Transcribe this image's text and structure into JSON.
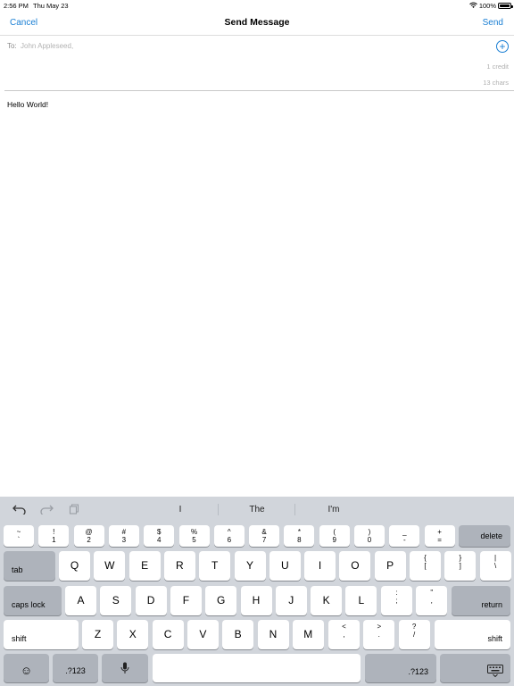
{
  "status_bar": {
    "time": "2:56 PM",
    "date": "Thu May 23",
    "battery_percent": "100%",
    "battery_level": 1.0
  },
  "nav": {
    "cancel": "Cancel",
    "title": "Send Message",
    "send": "Send"
  },
  "recipients": {
    "label": "To:",
    "value": "John Appleseed,",
    "add_icon": "plus-circle-icon"
  },
  "counters": {
    "credit": "1 credit",
    "chars": "13 chars"
  },
  "message": {
    "body": "Hello World!"
  },
  "keyboard": {
    "shortcuts": {
      "undo_icon": "undo-icon",
      "redo_icon": "redo-icon",
      "paste_icon": "clipboard-icon"
    },
    "suggestions": [
      "I",
      "The",
      "I'm"
    ],
    "row_numbers": [
      [
        "~",
        "`"
      ],
      [
        "!",
        "1"
      ],
      [
        "@",
        "2"
      ],
      [
        "#",
        "3"
      ],
      [
        "$",
        "4"
      ],
      [
        "%",
        "5"
      ],
      [
        "^",
        "6"
      ],
      [
        "&",
        "7"
      ],
      [
        "*",
        "8"
      ],
      [
        "(",
        "9"
      ],
      [
        ")",
        "0"
      ],
      [
        "_",
        "-"
      ],
      [
        "+",
        "="
      ]
    ],
    "delete": "delete",
    "tab": "tab",
    "row_qwerty": [
      "Q",
      "W",
      "E",
      "R",
      "T",
      "Y",
      "U",
      "I",
      "O",
      "P"
    ],
    "row_qwerty_symbols": [
      [
        "{",
        "["
      ],
      [
        "}",
        "]"
      ],
      [
        "|",
        "\\"
      ]
    ],
    "caps_lock": "caps lock",
    "row_asdf": [
      "A",
      "S",
      "D",
      "F",
      "G",
      "H",
      "J",
      "K",
      "L"
    ],
    "row_asdf_symbols": [
      [
        ":",
        ";"
      ],
      [
        "\"",
        ","
      ]
    ],
    "return": "return",
    "shift": "shift",
    "row_zxcv": [
      "Z",
      "X",
      "C",
      "V",
      "B",
      "N",
      "M"
    ],
    "row_zxcv_symbols": [
      [
        "<",
        ","
      ],
      [
        ">",
        "."
      ],
      [
        "?",
        "/"
      ]
    ],
    "emoji_icon": "emoji-icon",
    "numbers_left": ".?123",
    "mic_icon": "microphone-icon",
    "numbers_right": ".?123",
    "dismiss_icon": "keyboard-dismiss-icon"
  }
}
